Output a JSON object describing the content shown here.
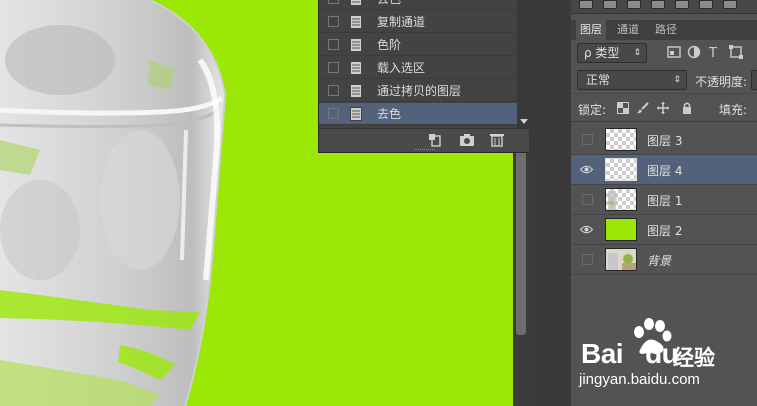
{
  "history": {
    "items": [
      {
        "label": "去色",
        "selected": false
      },
      {
        "label": "复制通道",
        "selected": false
      },
      {
        "label": "色阶",
        "selected": false
      },
      {
        "label": "载入选区",
        "selected": false
      },
      {
        "label": "通过拷贝的图层",
        "selected": false
      },
      {
        "label": "去色",
        "selected": true
      }
    ]
  },
  "layers_panel": {
    "tabs": [
      "图层",
      "通道",
      "路径"
    ],
    "active_tab": "图层",
    "filter": {
      "label": "ρ 类型"
    },
    "blend_mode": "正常",
    "opacity_label": "不透明度:",
    "lock_label": "锁定:",
    "fill_label": "填充:",
    "layers": [
      {
        "name": "图层 3",
        "visible": false,
        "thumb": "transparent",
        "selected": false
      },
      {
        "name": "图层 4",
        "visible": true,
        "thumb": "transparent",
        "selected": true
      },
      {
        "name": "图层 1",
        "visible": false,
        "thumb": "transparent-glass",
        "selected": false
      },
      {
        "name": "图层 2",
        "visible": true,
        "thumb": "green",
        "selected": false
      },
      {
        "name": "背景",
        "visible": false,
        "thumb": "photo",
        "selected": false
      }
    ]
  },
  "watermark": {
    "brand": "Bai",
    "brand2": "du",
    "cn": "经验",
    "url": "jingyan.baidu.com"
  },
  "colors": {
    "canvas_bg": "#9be806",
    "selected_row": "#53627a",
    "panel_bg": "#535353"
  }
}
